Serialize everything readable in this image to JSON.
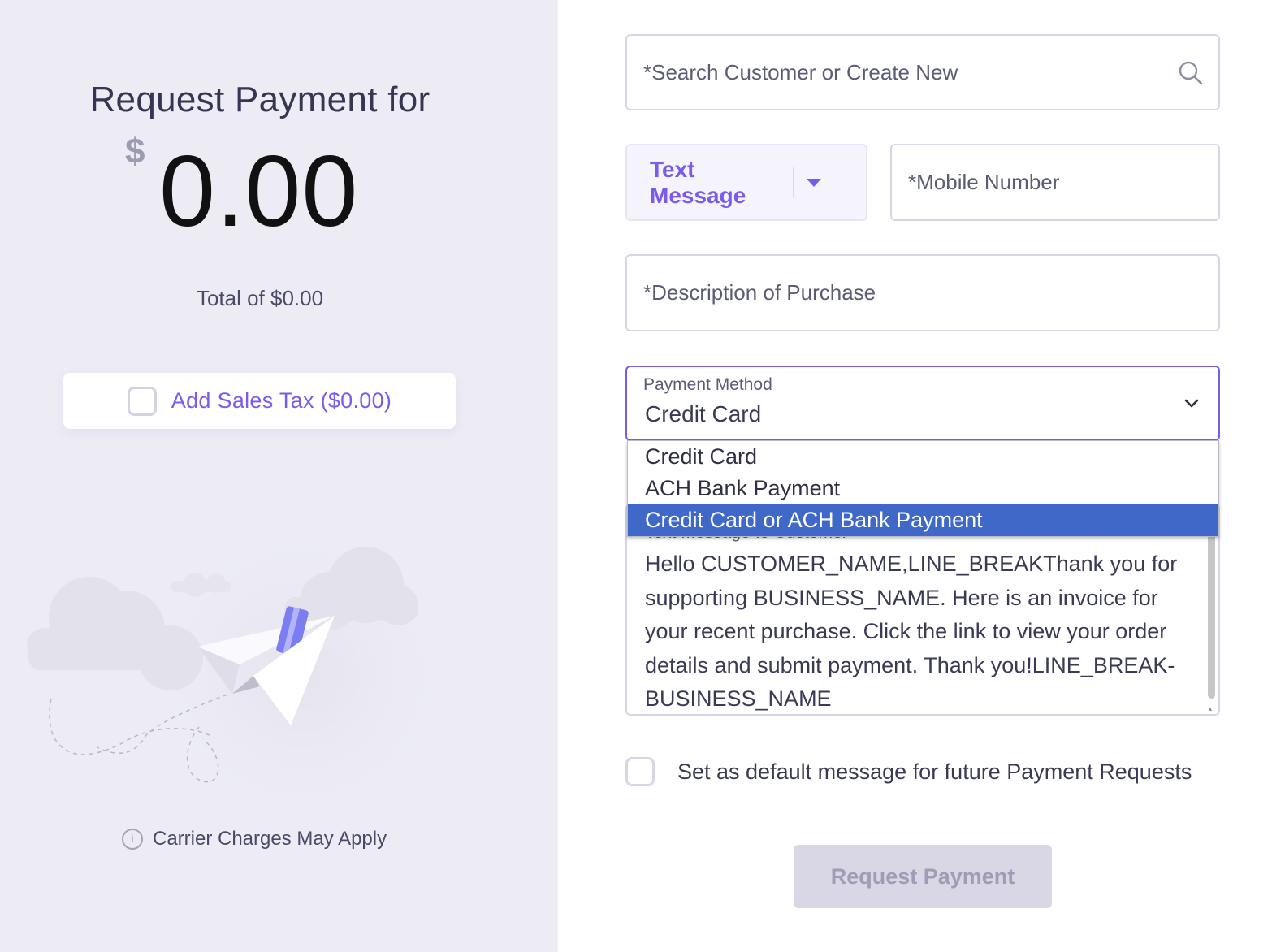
{
  "summary": {
    "title": "Request Payment for",
    "currency_symbol": "$",
    "amount": "0.00",
    "total_text": "Total of $0.00",
    "sales_tax": {
      "label": "Add Sales Tax ($0.00)",
      "checked": false
    },
    "illustration": "paper-plane-with-credit-card",
    "carrier_notice": "Carrier Charges May Apply",
    "info_icon_glyph": "i"
  },
  "form": {
    "customer_search": {
      "value": "",
      "placeholder": "*Search Customer or Create New",
      "icon": "search-icon"
    },
    "channel": {
      "selected": "Text Message",
      "icon": "caret-down-icon"
    },
    "mobile_number": {
      "value": "",
      "placeholder": "*Mobile Number"
    },
    "description": {
      "value": "",
      "placeholder": "*Description of Purchase"
    },
    "payment_method": {
      "label": "Payment Method",
      "selected": "Credit Card",
      "icon": "chevron-down-icon",
      "options": [
        "Credit Card",
        "ACH Bank Payment",
        "Credit Card or ACH Bank Payment"
      ],
      "highlighted_option": "Credit Card or ACH Bank Payment"
    },
    "message": {
      "label": "Text Message to Customer",
      "value": "Hello CUSTOMER_NAME,LINE_BREAKThank you for supporting BUSINESS_NAME. Here is an invoice for your recent purchase. Click the link to view your order details and submit payment. Thank you!LINE_BREAK-BUSINESS_NAME"
    },
    "set_default": {
      "label": "Set as default message for future Payment Requests",
      "checked": false
    },
    "submit_label": "Request Payment"
  },
  "colors": {
    "accent": "#7a5bea",
    "left_panel_bg": "#edecf5",
    "dropdown_highlight": "#4068c9",
    "disabled_button_bg": "#d9d7e6"
  }
}
